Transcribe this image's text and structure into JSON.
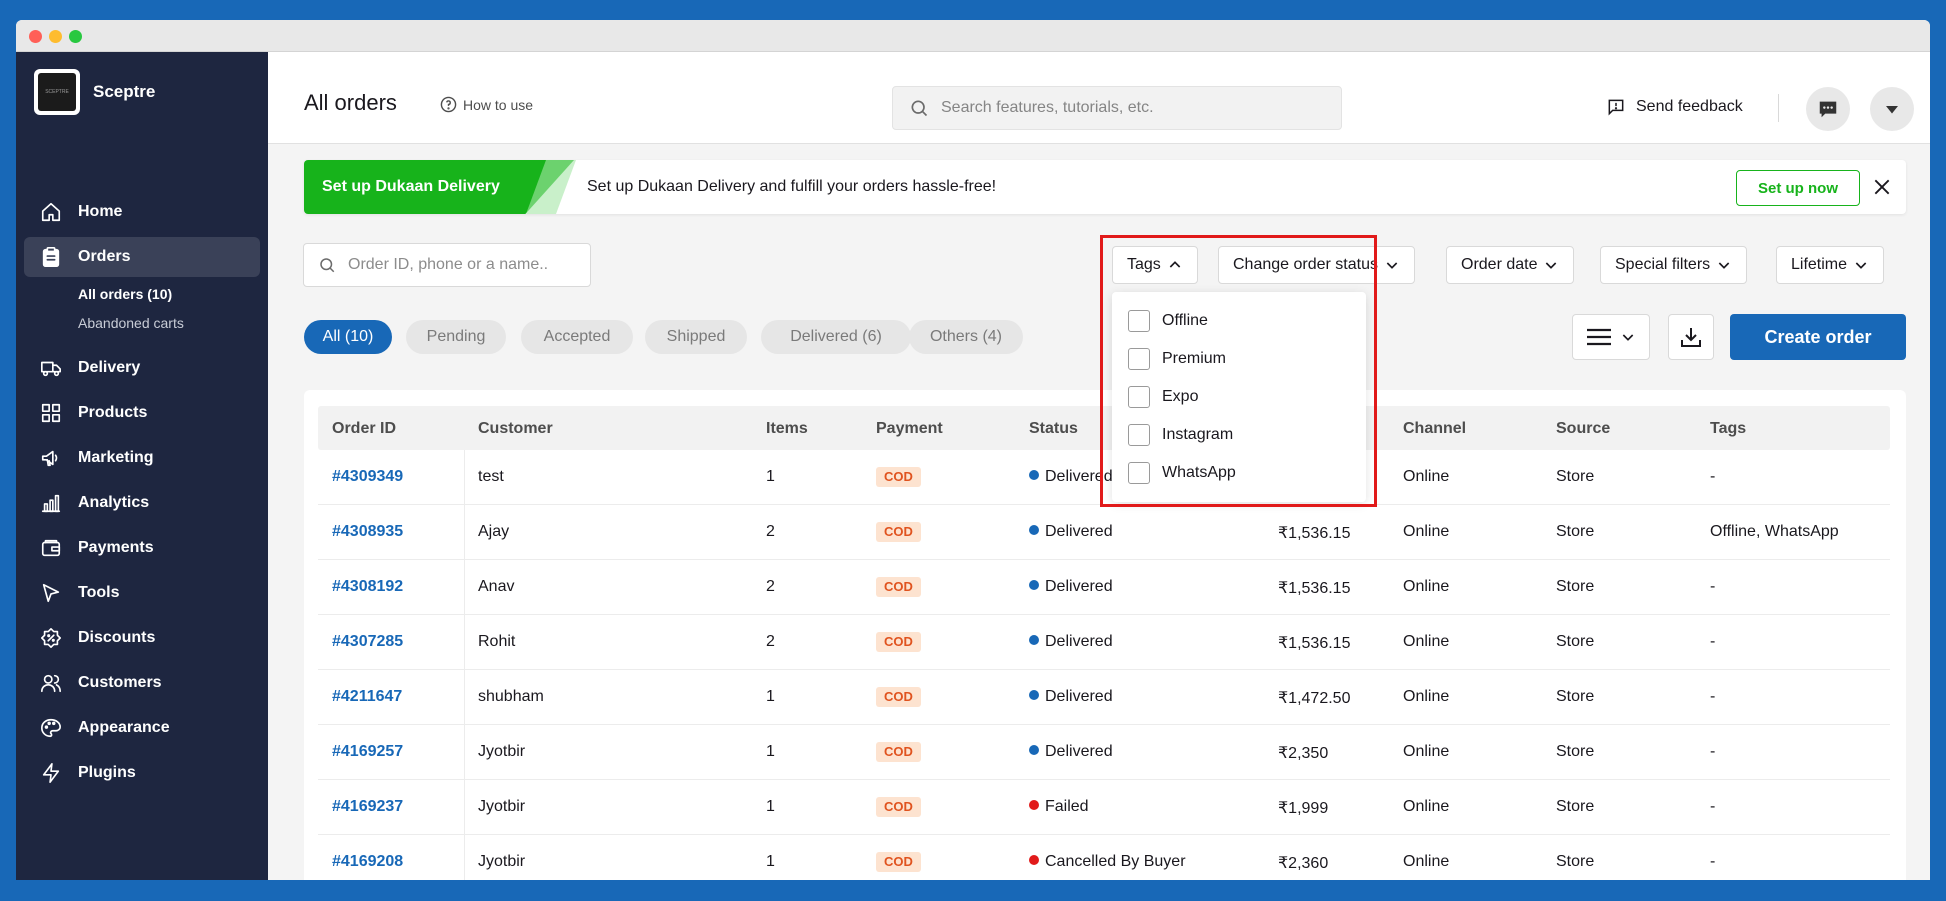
{
  "app": {
    "brand_name": "Sceptre",
    "logo_text": "SCEPTRE"
  },
  "sidebar": {
    "items": [
      {
        "label": "Home",
        "icon": "home-icon"
      },
      {
        "label": "Orders",
        "icon": "clipboard-icon",
        "active": true
      },
      {
        "label": "Delivery",
        "icon": "truck-icon"
      },
      {
        "label": "Products",
        "icon": "grid-icon"
      },
      {
        "label": "Marketing",
        "icon": "megaphone-icon"
      },
      {
        "label": "Analytics",
        "icon": "bar-chart-icon"
      },
      {
        "label": "Payments",
        "icon": "wallet-icon"
      },
      {
        "label": "Tools",
        "icon": "cursor-icon"
      },
      {
        "label": "Discounts",
        "icon": "percent-badge-icon"
      },
      {
        "label": "Customers",
        "icon": "users-icon"
      },
      {
        "label": "Appearance",
        "icon": "palette-icon"
      },
      {
        "label": "Plugins",
        "icon": "lightning-icon"
      }
    ],
    "orders_sub": [
      {
        "label": "All orders (10)",
        "active": true
      },
      {
        "label": "Abandoned carts"
      }
    ]
  },
  "header": {
    "title": "All orders",
    "how_to": "How to use",
    "search_placeholder": "Search features, tutorials, etc.",
    "feedback": "Send feedback"
  },
  "banner": {
    "badge": "Set up Dukaan Delivery",
    "text": "Set up Dukaan Delivery and fulfill your orders hassle-free!",
    "cta": "Set up now"
  },
  "filters": {
    "search_placeholder": "Order ID, phone or a name..",
    "tags": "Tags",
    "change_status": "Change order status",
    "order_date": "Order date",
    "special": "Special filters",
    "lifetime": "Lifetime",
    "tag_options": [
      "Offline",
      "Premium",
      "Expo",
      "Instagram",
      "WhatsApp"
    ]
  },
  "pills": [
    "All (10)",
    "Pending",
    "Accepted",
    "Shipped",
    "Delivered (6)",
    "Others (4)"
  ],
  "actions": {
    "create": "Create order"
  },
  "table": {
    "headers": [
      "Order ID",
      "Customer",
      "Items",
      "Payment",
      "Status",
      "Channel",
      "Source",
      "Tags"
    ],
    "rows": [
      {
        "id": "#4309349",
        "customer": "test",
        "items": "1",
        "payment": "COD",
        "status": "Delivered",
        "amount": "",
        "channel": "Online",
        "source": "Store",
        "tags": "-"
      },
      {
        "id": "#4308935",
        "customer": "Ajay",
        "items": "2",
        "payment": "COD",
        "status": "Delivered",
        "amount": "₹1,536.15",
        "channel": "Online",
        "source": "Store",
        "tags": "Offline, WhatsApp"
      },
      {
        "id": "#4308192",
        "customer": "Anav",
        "items": "2",
        "payment": "COD",
        "status": "Delivered",
        "amount": "₹1,536.15",
        "channel": "Online",
        "source": "Store",
        "tags": "-"
      },
      {
        "id": "#4307285",
        "customer": "Rohit",
        "items": "2",
        "payment": "COD",
        "status": "Delivered",
        "amount": "₹1,536.15",
        "channel": "Online",
        "source": "Store",
        "tags": "-"
      },
      {
        "id": "#4211647",
        "customer": "shubham",
        "items": "1",
        "payment": "COD",
        "status": "Delivered",
        "amount": "₹1,472.50",
        "channel": "Online",
        "source": "Store",
        "tags": "-"
      },
      {
        "id": "#4169257",
        "customer": "Jyotbir",
        "items": "1",
        "payment": "COD",
        "status": "Delivered",
        "amount": "₹2,350",
        "channel": "Online",
        "source": "Store",
        "tags": "-"
      },
      {
        "id": "#4169237",
        "customer": "Jyotbir",
        "items": "1",
        "payment": "COD",
        "status": "Failed",
        "amount": "₹1,999",
        "channel": "Online",
        "source": "Store",
        "tags": "-"
      },
      {
        "id": "#4169208",
        "customer": "Jyotbir",
        "items": "1",
        "payment": "COD",
        "status": "Cancelled By Buyer",
        "amount": "₹2,360",
        "channel": "Online",
        "source": "Store",
        "tags": "-"
      }
    ]
  },
  "colors": {
    "primary": "#1868b7",
    "sidebar": "#1e2640",
    "delivered": "#1868b7",
    "failed": "#e11a1a",
    "banner_green": "#17b31b",
    "highlight": "#e11a1a"
  }
}
